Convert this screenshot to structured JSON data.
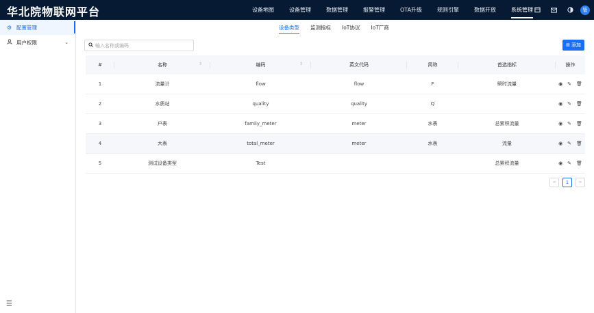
{
  "brand": "华北院物联网平台",
  "nav": [
    "设备地图",
    "设备管理",
    "数据管理",
    "报警管理",
    "OTA升级",
    "规则引擎",
    "数据开放",
    "系统管理"
  ],
  "nav_active": 7,
  "top_icons": [
    "window-icon",
    "mail-icon",
    "theme-icon",
    "user-avatar-icon"
  ],
  "avatar_text": "管",
  "sidebar": {
    "items": [
      {
        "icon": "gear-icon",
        "label": "配置管理",
        "active": true
      },
      {
        "icon": "user-icon",
        "label": "用户权限",
        "active": false,
        "has_chevron": true
      }
    ],
    "collapse_icon": "collapse-icon"
  },
  "tabs": [
    "设备类型",
    "监测指标",
    "IoT协议",
    "IoT厂商"
  ],
  "tab_active": 0,
  "search": {
    "placeholder": "输入名称或编码"
  },
  "add_button": "添加",
  "table": {
    "headers": [
      "#",
      "名称",
      "编码",
      "英文代码",
      "简称",
      "首选指标",
      "操作"
    ],
    "rows": [
      {
        "idx": "1",
        "name": "流量计",
        "code": "flow",
        "en": "flow",
        "abbr": "F",
        "metric": "瞬时流量"
      },
      {
        "idx": "2",
        "name": "水质站",
        "code": "quality",
        "en": "quality",
        "abbr": "Q",
        "metric": ""
      },
      {
        "idx": "3",
        "name": "户表",
        "code": "family_meter",
        "en": "meter",
        "abbr": "水表",
        "metric": "总累积流量"
      },
      {
        "idx": "4",
        "name": "大表",
        "code": "total_meter",
        "en": "meter",
        "abbr": "水表",
        "metric": "流量"
      },
      {
        "idx": "5",
        "name": "测试设备类型",
        "code": "Test",
        "en": "",
        "abbr": "",
        "metric": "总累积流量"
      }
    ],
    "row_actions": [
      "view-icon",
      "edit-icon",
      "delete-icon"
    ]
  },
  "pagination": {
    "prev": "<",
    "current": "1",
    "next": ">"
  }
}
